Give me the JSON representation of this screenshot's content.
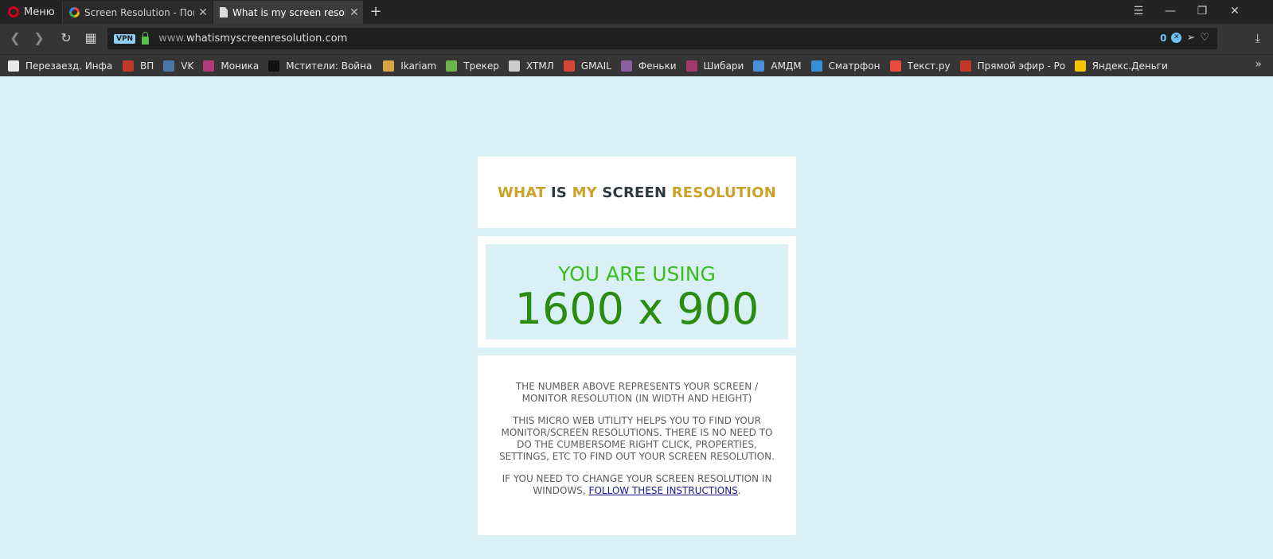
{
  "browser": {
    "menu_label": "Меню",
    "tabs": [
      {
        "title": "Screen Resolution - Поиск",
        "active": false
      },
      {
        "title": "What is my screen resolutio",
        "active": true
      }
    ],
    "new_tab": "+",
    "url_host_dim": "www.",
    "url_host": "whatismyscreenresolution.com",
    "vpn_label": "VPN",
    "adblock_count": "0",
    "bookmarks": [
      {
        "label": "Перезаезд. Инфа,Пр",
        "icon": "okx-icon",
        "color": "#e9e9e9"
      },
      {
        "label": "ВП",
        "icon": "vp-icon",
        "color": "#c0392b"
      },
      {
        "label": "VK",
        "icon": "vk-icon",
        "color": "#4a76a8"
      },
      {
        "label": "Моника",
        "icon": "monika-icon",
        "color": "#b03a7a"
      },
      {
        "label": "Мстители: Война бе",
        "icon": "hd-icon",
        "color": "#111111"
      },
      {
        "label": "Ikariam",
        "icon": "ikariam-icon",
        "color": "#d9a441"
      },
      {
        "label": "Трекер",
        "icon": "tracker-icon",
        "color": "#6bb34a"
      },
      {
        "label": "ХТМЛ",
        "icon": "shield-icon",
        "color": "#cccccc"
      },
      {
        "label": "GMAIL",
        "icon": "gmail-icon",
        "color": "#d44638"
      },
      {
        "label": "Феньки",
        "icon": "checker-icon",
        "color": "#8a5fa0"
      },
      {
        "label": "Шибари",
        "icon": "shibari-icon",
        "color": "#a33a6b"
      },
      {
        "label": "АМДМ",
        "icon": "amdm-icon",
        "color": "#4a90d9"
      },
      {
        "label": "Сматрфон",
        "icon": "u-icon",
        "color": "#3a8fd9"
      },
      {
        "label": "Текст.ру",
        "icon": "c-icon",
        "color": "#e74c3c"
      },
      {
        "label": "Прямой эфир - Росс",
        "icon": "channel1-icon",
        "color": "#c0392b"
      },
      {
        "label": "Яндекс.Деньги",
        "icon": "yandex-money-icon",
        "color": "#f5c400"
      }
    ]
  },
  "page": {
    "title_words": [
      "WHAT",
      "IS",
      "MY",
      "SCREEN",
      "RESOLUTION"
    ],
    "using_label": "YOU ARE USING",
    "resolution": "1600 x 900",
    "para1": "THE NUMBER ABOVE REPRESENTS YOUR SCREEN / MONITOR RESOLUTION (IN WIDTH AND HEIGHT)",
    "para2": "THIS MICRO WEB UTILITY HELPS YOU TO FIND YOUR MONITOR/SCREEN RESOLUTIONS. THERE IS NO NEED TO DO THE CUMBERSOME RIGHT CLICK, PROPERTIES, SETTINGS, ETC TO FIND OUT YOUR SCREEN RESOLUTION.",
    "para3_prefix": "IF YOU NEED TO CHANGE YOUR SCREEN RESOLUTION IN WINDOWS, ",
    "para3_link": "FOLLOW THESE INSTRUCTIONS",
    "para3_suffix": "."
  }
}
